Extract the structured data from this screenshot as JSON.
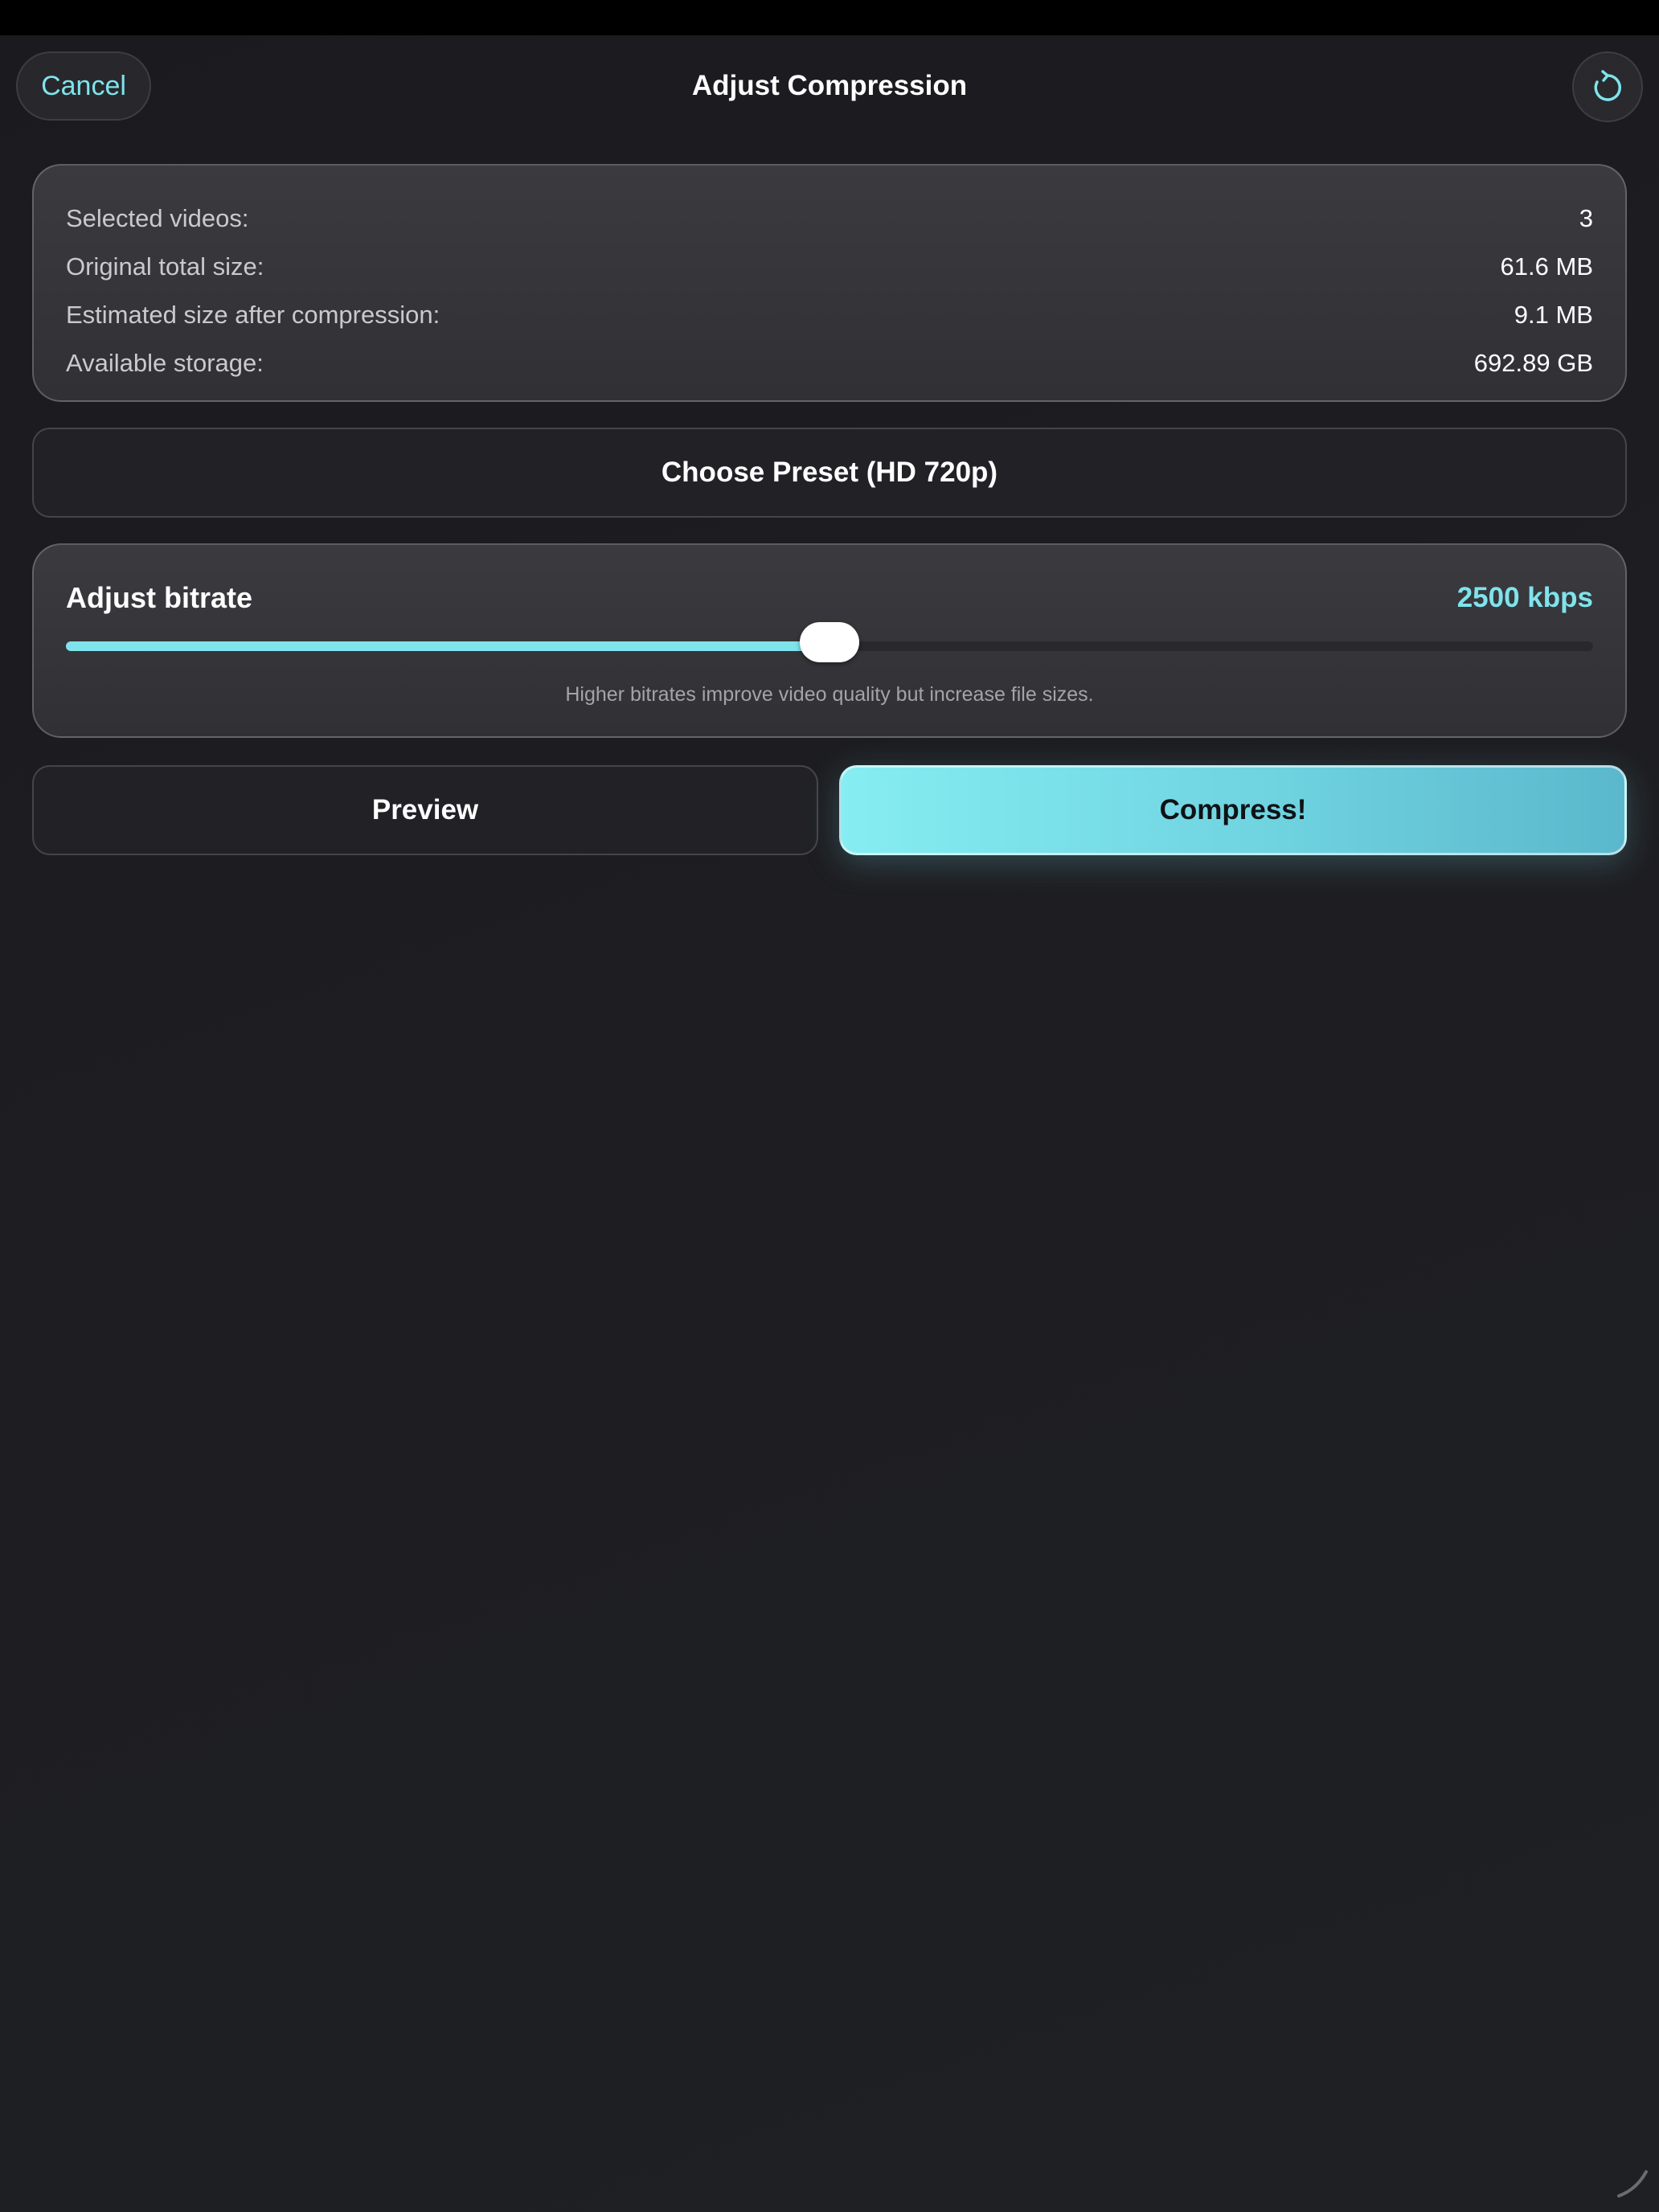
{
  "nav": {
    "cancel_label": "Cancel",
    "title": "Adjust Compression",
    "reset_icon": "reset-icon"
  },
  "summary": {
    "rows": [
      {
        "label": "Selected videos:",
        "value": "3"
      },
      {
        "label": "Original total size:",
        "value": "61.6 MB"
      },
      {
        "label": "Estimated size after compression:",
        "value": "9.1 MB"
      },
      {
        "label": "Available storage:",
        "value": "692.89 GB"
      }
    ]
  },
  "preset": {
    "label": "Choose Preset (HD 720p)"
  },
  "bitrate": {
    "title": "Adjust bitrate",
    "value_label": "2500 kbps",
    "slider_fraction": 0.5,
    "hint": "Higher bitrates improve video quality but increase file sizes."
  },
  "actions": {
    "preview_label": "Preview",
    "compress_label": "Compress!"
  },
  "colors": {
    "accent": "#7fe3ec",
    "background": "#1e1e22",
    "card": "#36363b"
  }
}
